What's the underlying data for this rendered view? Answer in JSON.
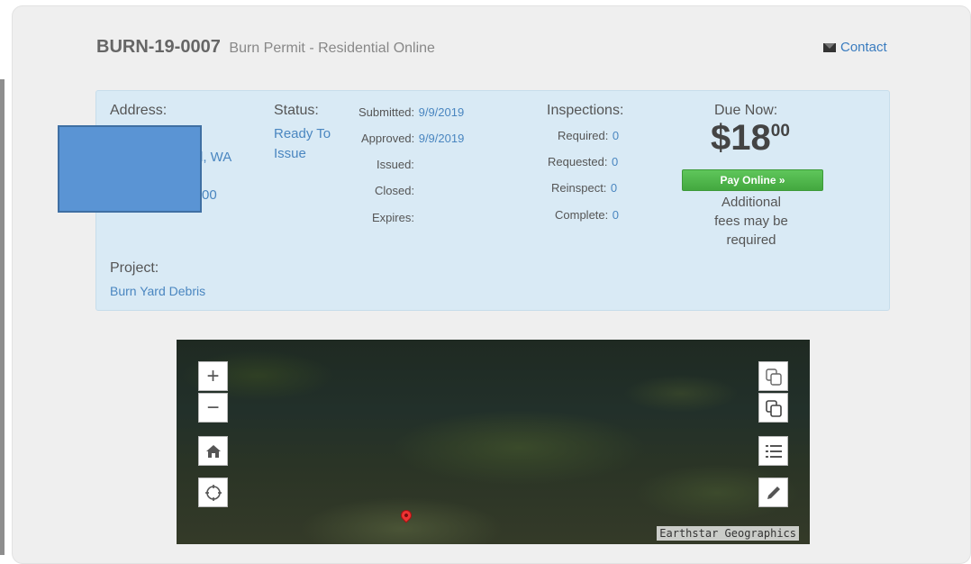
{
  "header": {
    "permit_number": "BURN-19-0007",
    "permit_type": "Burn Permit - Residential Online",
    "contact_label": "Contact"
  },
  "address": {
    "label": "Address:",
    "line2_visible": "d,  WA",
    "line3_visible": "00"
  },
  "status": {
    "label": "Status:",
    "value_line1": "Ready To",
    "value_line2": "Issue"
  },
  "dates": {
    "submitted_label": "Submitted:",
    "submitted_value": "9/9/2019",
    "approved_label": "Approved:",
    "approved_value": "9/9/2019",
    "issued_label": "Issued:",
    "closed_label": "Closed:",
    "expires_label": "Expires:"
  },
  "inspections": {
    "label": "Inspections:",
    "required_label": "Required:",
    "required_value": "0",
    "requested_label": "Requested:",
    "requested_value": "0",
    "reinspect_label": "Reinspect:",
    "reinspect_value": "0",
    "complete_label": "Complete:",
    "complete_value": "0"
  },
  "due": {
    "label": "Due Now:",
    "amount_main": "$18",
    "amount_cents": "00",
    "pay_button": "Pay Online »",
    "note_line1": "Additional",
    "note_line2": "fees may be",
    "note_line3": "required"
  },
  "project": {
    "label": "Project:",
    "value": "Burn Yard Debris"
  },
  "map": {
    "zoom_in": "+",
    "zoom_out": "−",
    "attribution": "Earthstar Geographics"
  },
  "colors": {
    "info_box_bg": "#d9eaf5",
    "link_blue": "#4a86c0",
    "pay_green": "#4cb048",
    "redaction_blue": "#5a94d4"
  }
}
